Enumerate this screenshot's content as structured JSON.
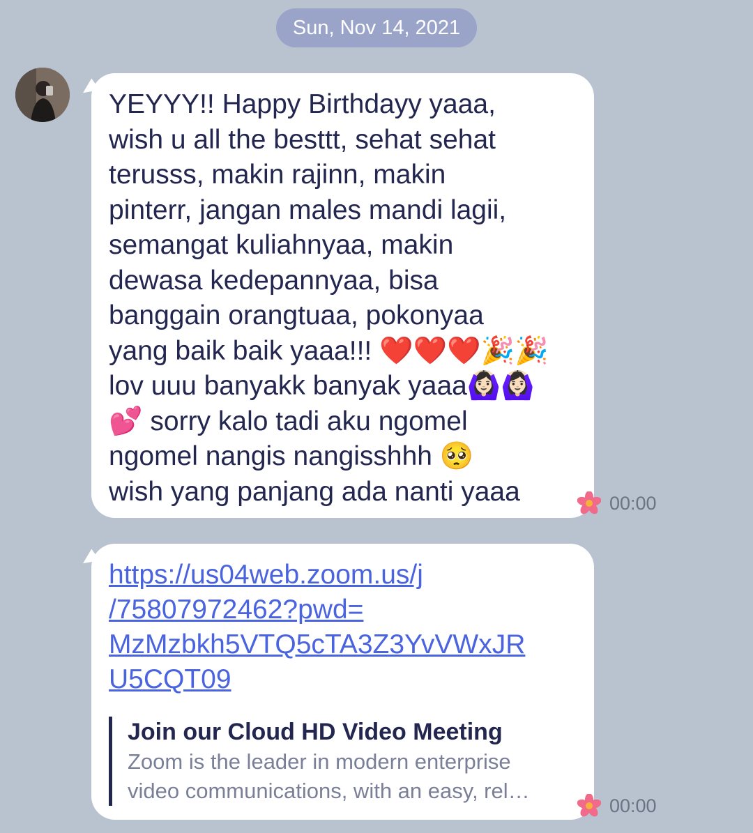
{
  "date_separator": "Sun, Nov 14, 2021",
  "messages": [
    {
      "text": "YEYYY!! Happy Birthdayy yaaa,\nwish u all the besttt, sehat sehat\nterusss, makin rajinn, makin\npinterr, jangan males mandi lagii,\nsemangat kuliahnyaa, makin\ndewasa kedepannyaa, bisa\nbanggain orangtuaa, pokonyaa\nyang baik baik yaaa!!! ❤️❤️❤️🎉🎉\nlov uuu banyakk banyak yaaa🙆🏻‍♀️🙆🏻‍♀️\n💕 sorry kalo tadi aku ngomel\nngomel nangis nangisshhh 🥺\nwish yang panjang ada nanti yaaa",
      "time": "00:00"
    },
    {
      "link_lines": "https://us04web.zoom.us/j\n/75807972462?pwd=\nMzMzbkh5VTQ5cTA3Z3YvVWxJR\nU5CQT09",
      "preview_title": "Join our Cloud HD Video Meeting",
      "preview_desc_1": "Zoom is the leader in modern enterprise",
      "preview_desc_2": "video communications, with an easy, rel…",
      "time": "00:00"
    }
  ],
  "icons": {
    "reaction": "flower-icon"
  },
  "colors": {
    "background": "#b9c2cf",
    "bubble": "#ffffff",
    "text": "#23264f",
    "link": "#4a63df",
    "date_pill": "#9aa3c8"
  }
}
